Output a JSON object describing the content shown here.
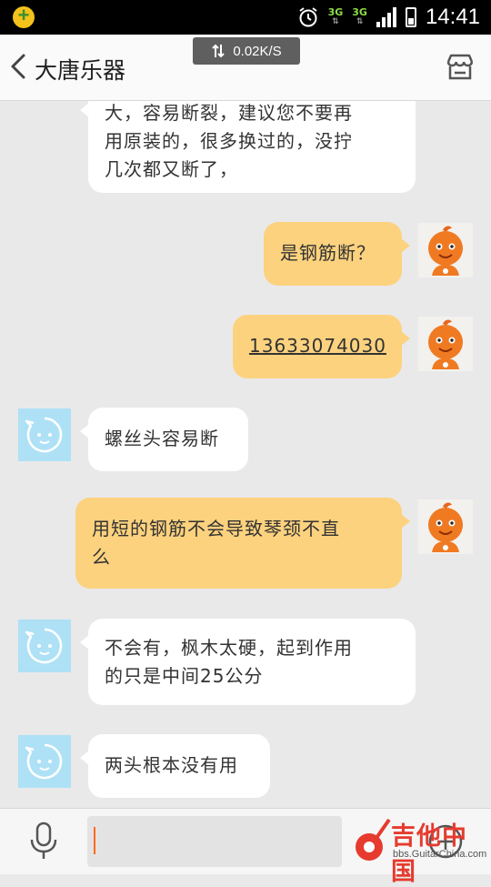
{
  "status_bar": {
    "network_1": "3G",
    "network_2": "3G",
    "time": "14:41"
  },
  "header": {
    "title": "大唐乐器",
    "speed": "0.02K/S"
  },
  "messages": [
    {
      "side": "in",
      "text_lines": [
        "大，容易断裂，建议您不要再",
        "用原装的，很多换过的，没拧",
        "几次都又断了，"
      ]
    },
    {
      "side": "out",
      "text_lines": [
        "是钢筋断？"
      ]
    },
    {
      "side": "out",
      "text_lines": [
        "13633074030"
      ],
      "is_link": true
    },
    {
      "side": "in",
      "text_lines": [
        "螺丝头容易断"
      ]
    },
    {
      "side": "out",
      "text_lines": [
        "用短的钢筋不会导致琴颈不直",
        "么"
      ]
    },
    {
      "side": "in",
      "text_lines": [
        "不会有，枫木太硬，起到作用",
        "的只是中间25公分"
      ]
    },
    {
      "side": "in",
      "text_lines": [
        "两头根本没有用"
      ]
    }
  ],
  "input": {
    "value": "",
    "placeholder": ""
  },
  "watermark": {
    "title": "吉他中国",
    "url": "bbs.GuitarChina.com"
  },
  "colors": {
    "incoming_bubble": "#ffffff",
    "outgoing_bubble": "#fcd27e",
    "background": "#e9e9ea",
    "incoming_avatar": "#aee1f6",
    "caret": "#ff6a1f"
  }
}
